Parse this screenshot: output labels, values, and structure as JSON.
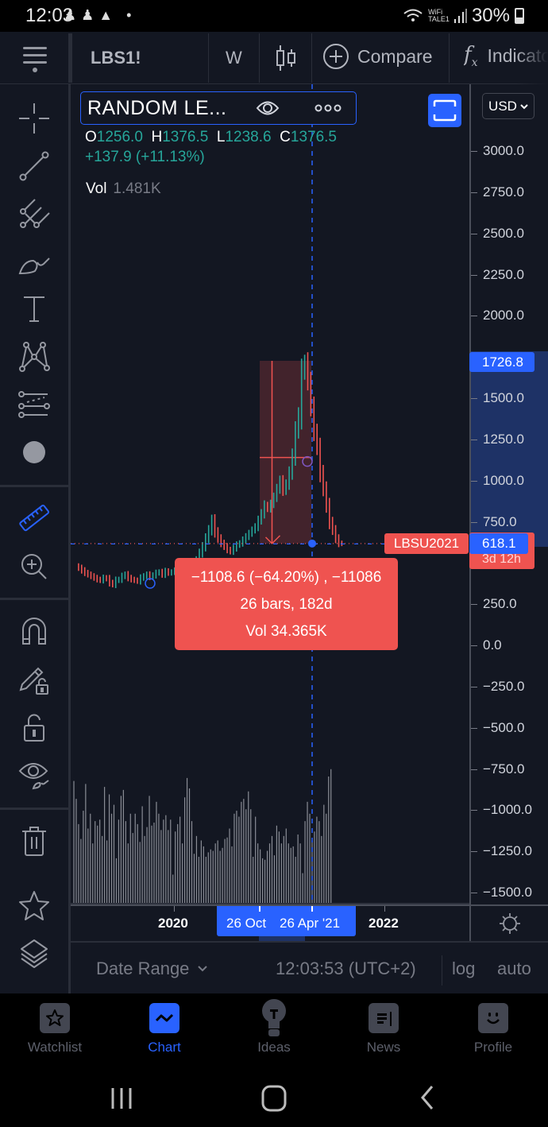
{
  "status_bar": {
    "time": "12:03",
    "wifi_label_top": "WiFi",
    "wifi_label_bottom": "TALE1",
    "battery": "30%"
  },
  "toolbar": {
    "symbol": "LBS1!",
    "interval": "W",
    "compare_label": "Compare",
    "indicators_label": "Indicators"
  },
  "legend": {
    "title": "RANDOM LE...",
    "open_key": "O",
    "open": "1256.0",
    "high_key": "H",
    "high": "1376.5",
    "low_key": "L",
    "low": "1238.6",
    "close_key": "C",
    "close": "1376.5",
    "change": "+137.9 (+11.13%)",
    "volume_key": "Vol",
    "volume": "1.481K"
  },
  "currency_selector": "USD",
  "price_scale": {
    "labels": [
      "3000.0",
      "2750.0",
      "2500.0",
      "2250.0",
      "2000.0",
      "1500.0",
      "1250.0",
      "1000.0",
      "750.0",
      "250.0",
      "0.0",
      "−250.0",
      "−500.0",
      "−750.0",
      "−1000.0",
      "−1250.0",
      "−1500.0"
    ],
    "highlight_top": "1726.8",
    "last_price": "618.1",
    "countdown": "3d 12h",
    "symbol_tag": "LBSU2021"
  },
  "measure_tooltip": {
    "line1": "−1108.6 (−64.20%) , −11086",
    "line2": "26 bars, 182d",
    "line3": "Vol 34.365K"
  },
  "time_axis": {
    "labels": [
      "2020",
      "2022"
    ],
    "range_start": "26 Oct",
    "range_end": "26 Apr '21"
  },
  "bottom_bar": {
    "date_range": "Date Range",
    "clock": "12:03:53 (UTC+2)",
    "log": "log",
    "auto": "auto"
  },
  "app_nav": [
    {
      "label": "Watchlist",
      "icon": "star-icon",
      "active": false
    },
    {
      "label": "Chart",
      "icon": "chart-icon",
      "active": true
    },
    {
      "label": "Ideas",
      "icon": "lightbulb-icon",
      "active": false
    },
    {
      "label": "News",
      "icon": "newspaper-icon",
      "active": false
    },
    {
      "label": "Profile",
      "icon": "smiley-icon",
      "active": false
    }
  ],
  "colors": {
    "accent": "#2962ff",
    "up": "#26a69a",
    "down": "#ef5350",
    "background": "#131722"
  },
  "chart_data": {
    "type": "candlestick",
    "symbol": "LBS1!",
    "interval": "W",
    "ylim": [
      -1600,
      3100
    ],
    "x_labels": [
      "2020",
      "26 Oct",
      "26 Apr '21",
      "2022"
    ],
    "price_path": [
      480,
      470,
      455,
      440,
      430,
      420,
      410,
      400,
      395,
      410,
      405,
      380,
      370,
      395,
      400,
      420,
      430,
      410,
      400,
      395,
      390,
      410,
      420,
      430,
      415,
      425,
      440,
      445,
      430,
      450,
      440,
      445,
      455,
      470,
      480,
      490,
      480,
      470,
      500,
      520,
      560,
      600,
      650,
      700,
      760,
      690,
      650,
      620,
      600,
      580,
      570,
      590,
      610,
      620,
      640,
      660,
      680,
      700,
      720,
      760,
      800,
      850,
      830,
      860,
      900,
      950,
      1000,
      940,
      980,
      1050,
      1150,
      1300,
      1400,
      1650,
      1726,
      1600,
      1450,
      1300,
      1200,
      1050,
      950,
      850,
      750,
      700,
      650,
      620,
      618
    ],
    "volume_relative": [
      0.82,
      0.7,
      0.53,
      0.43,
      0.62,
      0.8,
      0.5,
      0.6,
      0.4,
      0.55,
      0.52,
      0.56,
      0.45,
      0.78,
      0.42,
      0.73,
      0.6,
      0.66,
      0.3,
      0.56,
      0.72,
      0.76,
      0.55,
      0.4,
      0.6,
      0.47,
      0.6,
      0.53,
      0.41,
      0.65,
      0.45,
      0.51,
      0.72,
      0.52,
      0.54,
      0.68,
      0.6,
      0.49,
      0.56,
      0.59,
      0.49,
      0.56,
      0.19,
      0.48,
      0.53,
      0.58,
      0.4,
      0.71,
      0.84,
      0.77,
      0.55,
      0.33,
      0.45,
      0.31,
      0.42,
      0.38,
      0.31,
      0.34,
      0.36,
      0.35,
      0.4,
      0.42,
      0.35,
      0.37,
      0.43,
      0.44,
      0.5,
      0.38,
      0.6,
      0.62,
      0.58,
      0.68,
      0.7,
      0.63,
      0.75,
      0.63,
      0.31,
      0.58,
      0.4,
      0.36,
      0.3,
      0.29,
      0.35,
      0.4,
      0.45,
      0.32,
      0.52,
      0.48,
      0.4,
      0.45,
      0.5,
      0.4,
      0.37,
      0.38,
      0.31,
      0.46,
      0.4,
      0.2,
      0.55,
      0.68,
      0.6,
      0.42,
      0.48,
      0.58,
      0.55,
      0.45,
      0.66,
      0.6,
      0.85,
      0.9
    ],
    "measure": {
      "from_price": 1726.8,
      "to_price": 618.1,
      "change": -1108.6,
      "change_pct": -64.2,
      "bars": 26,
      "days": 182,
      "volume": "34.365K"
    },
    "last_price": 618.1
  }
}
